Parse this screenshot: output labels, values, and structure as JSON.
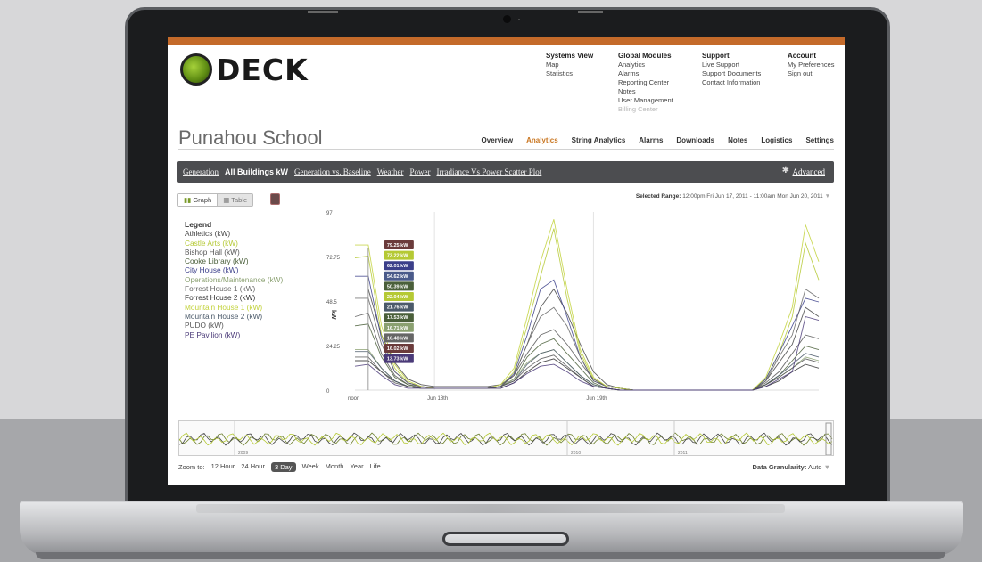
{
  "logo": {
    "text": "DECK"
  },
  "nav": {
    "systems_view": {
      "heading": "Systems View",
      "items": [
        "Map",
        "Statistics"
      ]
    },
    "global_modules": {
      "heading": "Global Modules",
      "items": [
        "Analytics",
        "Alarms",
        "Reporting Center",
        "Notes",
        "User Management"
      ],
      "disabled_item": "Billing Center"
    },
    "support": {
      "heading": "Support",
      "items": [
        "Live Support",
        "Support Documents",
        "Contact Information"
      ]
    },
    "account": {
      "heading": "Account",
      "items": [
        "My Preferences",
        "Sign out"
      ]
    }
  },
  "page": {
    "title": "Punahou School"
  },
  "tabs": [
    "Overview",
    "Analytics",
    "String Analytics",
    "Alarms",
    "Downloads",
    "Notes",
    "Logistics",
    "Settings"
  ],
  "active_tab": "Analytics",
  "subnav": {
    "items": [
      "Generation",
      "All Buildings kW",
      "Generation vs. Baseline",
      "Weather",
      "Power",
      "Irradiance Vs Power Scatter Plot"
    ],
    "current": "All Buildings kW",
    "advanced": "Advanced"
  },
  "view_toggle": {
    "graph": "Graph",
    "table": "Table"
  },
  "selected_range": {
    "label": "Selected Range:",
    "value": "12:00pm Fri Jun 17, 2011 - 11:00am Mon Jun 20, 2011"
  },
  "legend": {
    "title": "Legend",
    "items": [
      {
        "name": "Athletics (kW)",
        "color": "#444444"
      },
      {
        "name": "Castle Arts (kW)",
        "color": "#b5c934"
      },
      {
        "name": "Bishop Hall (kW)",
        "color": "#555555"
      },
      {
        "name": "Cooke Library (kW)",
        "color": "#4a5f3a"
      },
      {
        "name": "City House (kW)",
        "color": "#3b3f8a"
      },
      {
        "name": "Operations/Maintenance (kW)",
        "color": "#8aa070"
      },
      {
        "name": "Forrest House 1 (kW)",
        "color": "#666666"
      },
      {
        "name": "Forrest House 2 (kW)",
        "color": "#333333"
      },
      {
        "name": "Mountain House 1 (kW)",
        "color": "#c2d23a"
      },
      {
        "name": "Mountain House 2 (kW)",
        "color": "#4b5a6a"
      },
      {
        "name": "PUDO (kW)",
        "color": "#555555"
      },
      {
        "name": "PE Pavilion (kW)",
        "color": "#4a3a78"
      }
    ]
  },
  "chart_data": {
    "type": "line",
    "ylabel": "kW",
    "ylim": [
      0,
      97
    ],
    "y_ticks": [
      "97",
      "72.75",
      "48.5",
      "24.25",
      "0"
    ],
    "x_ticks": [
      "noon",
      "Jun 18th",
      "Jun 19th"
    ],
    "x_hours": [
      0,
      2,
      4,
      6,
      8,
      10,
      12,
      14,
      16,
      18,
      20,
      22,
      24,
      26,
      28,
      30,
      32,
      34,
      36,
      38,
      40,
      42,
      44,
      46,
      48,
      50,
      52,
      54,
      56,
      58,
      60,
      62,
      64,
      66,
      68,
      70
    ],
    "series": [
      {
        "color": "#444444",
        "values": [
          55,
          55,
          30,
          15,
          6,
          3,
          2,
          2,
          2,
          2,
          2,
          3,
          8,
          25,
          45,
          55,
          42,
          25,
          10,
          3,
          1,
          0,
          0,
          0,
          0,
          0,
          0,
          0,
          0,
          0,
          0,
          5,
          15,
          25,
          45,
          40
        ]
      },
      {
        "color": "#b5c934",
        "values": [
          72,
          73,
          30,
          12,
          4,
          2,
          1,
          1,
          1,
          1,
          1,
          2,
          10,
          35,
          62,
          88,
          50,
          20,
          6,
          2,
          1,
          0,
          0,
          0,
          0,
          0,
          0,
          0,
          0,
          0,
          0,
          6,
          20,
          40,
          80,
          60
        ]
      },
      {
        "color": "#555555",
        "values": [
          40,
          42,
          20,
          8,
          3,
          2,
          1,
          1,
          1,
          1,
          1,
          2,
          8,
          20,
          30,
          33,
          25,
          15,
          6,
          2,
          1,
          0,
          0,
          0,
          0,
          0,
          0,
          0,
          0,
          0,
          0,
          4,
          10,
          20,
          30,
          28
        ]
      },
      {
        "color": "#4a5f3a",
        "values": [
          35,
          36,
          18,
          7,
          3,
          1,
          1,
          1,
          1,
          1,
          1,
          2,
          6,
          18,
          25,
          28,
          20,
          12,
          4,
          1,
          0,
          0,
          0,
          0,
          0,
          0,
          0,
          0,
          0,
          0,
          0,
          3,
          8,
          16,
          24,
          22
        ]
      },
      {
        "color": "#3b3f8a",
        "values": [
          62,
          62,
          28,
          10,
          4,
          2,
          1,
          1,
          1,
          1,
          1,
          2,
          9,
          30,
          55,
          60,
          40,
          18,
          5,
          2,
          1,
          0,
          0,
          0,
          0,
          0,
          0,
          0,
          0,
          0,
          0,
          6,
          20,
          35,
          50,
          48
        ]
      },
      {
        "color": "#8aa070",
        "values": [
          22,
          22,
          12,
          5,
          2,
          1,
          1,
          1,
          1,
          1,
          1,
          2,
          6,
          15,
          20,
          22,
          15,
          8,
          3,
          1,
          0,
          0,
          0,
          0,
          0,
          0,
          0,
          0,
          0,
          0,
          0,
          3,
          7,
          12,
          18,
          16
        ]
      },
      {
        "color": "#666666",
        "values": [
          50,
          50,
          25,
          10,
          4,
          2,
          1,
          1,
          1,
          1,
          1,
          2,
          8,
          25,
          40,
          45,
          35,
          18,
          5,
          2,
          1,
          0,
          0,
          0,
          0,
          0,
          0,
          0,
          0,
          0,
          0,
          5,
          18,
          30,
          55,
          50
        ]
      },
      {
        "color": "#333333",
        "values": [
          16,
          16,
          10,
          5,
          2,
          1,
          1,
          1,
          1,
          1,
          1,
          1,
          4,
          10,
          15,
          17,
          12,
          7,
          2,
          1,
          0,
          0,
          0,
          0,
          0,
          0,
          0,
          0,
          0,
          0,
          0,
          2,
          5,
          10,
          14,
          12
        ]
      },
      {
        "color": "#c2d23a",
        "values": [
          79,
          79,
          35,
          14,
          5,
          2,
          1,
          1,
          1,
          1,
          1,
          3,
          12,
          40,
          70,
          93,
          55,
          22,
          7,
          2,
          1,
          0,
          0,
          0,
          0,
          0,
          0,
          0,
          0,
          0,
          0,
          7,
          25,
          45,
          90,
          70
        ]
      },
      {
        "color": "#4b5a6a",
        "values": [
          21,
          21,
          12,
          5,
          2,
          1,
          1,
          1,
          1,
          1,
          1,
          2,
          5,
          14,
          20,
          22,
          15,
          8,
          3,
          1,
          0,
          0,
          0,
          0,
          0,
          0,
          0,
          0,
          0,
          0,
          0,
          3,
          8,
          14,
          20,
          18
        ]
      },
      {
        "color": "#555555",
        "values": [
          18,
          18,
          10,
          4,
          2,
          1,
          1,
          1,
          1,
          1,
          1,
          2,
          5,
          12,
          17,
          19,
          13,
          7,
          2,
          1,
          0,
          0,
          0,
          0,
          0,
          0,
          0,
          0,
          0,
          0,
          0,
          3,
          7,
          12,
          17,
          15
        ]
      },
      {
        "color": "#4a3a78",
        "values": [
          13,
          14,
          8,
          3,
          1,
          1,
          1,
          1,
          1,
          1,
          1,
          1,
          4,
          9,
          13,
          14,
          10,
          5,
          2,
          1,
          0,
          0,
          0,
          0,
          0,
          0,
          0,
          0,
          0,
          0,
          0,
          2,
          6,
          10,
          40,
          38
        ]
      }
    ],
    "tooltips": [
      {
        "label": "79.25 kW",
        "color": "#6b3b3b"
      },
      {
        "label": "73.22 kW",
        "color": "#b5c934"
      },
      {
        "label": "62.01 kW",
        "color": "#3b3f8a"
      },
      {
        "label": "54.62 kW",
        "color": "#4a5a8a"
      },
      {
        "label": "50.39 kW",
        "color": "#4a5f3a"
      },
      {
        "label": "22.04 kW",
        "color": "#b5c934"
      },
      {
        "label": "21.76 kW",
        "color": "#4b5a6a"
      },
      {
        "label": "17.53 kW",
        "color": "#4a5f3a"
      },
      {
        "label": "16.71 kW",
        "color": "#8aa070"
      },
      {
        "label": "16.48 kW",
        "color": "#666666"
      },
      {
        "label": "16.02 kW",
        "color": "#6b3b3b"
      },
      {
        "label": "13.73 kW",
        "color": "#4a3a78"
      }
    ]
  },
  "navigator": {
    "years": [
      "2009",
      "2010",
      "2011"
    ]
  },
  "zoom": {
    "label": "Zoom to:",
    "options": [
      "12 Hour",
      "24 Hour",
      "3 Day",
      "Week",
      "Month",
      "Year",
      "Life"
    ],
    "selected": "3 Day"
  },
  "granularity": {
    "label": "Data Granularity:",
    "value": "Auto"
  }
}
